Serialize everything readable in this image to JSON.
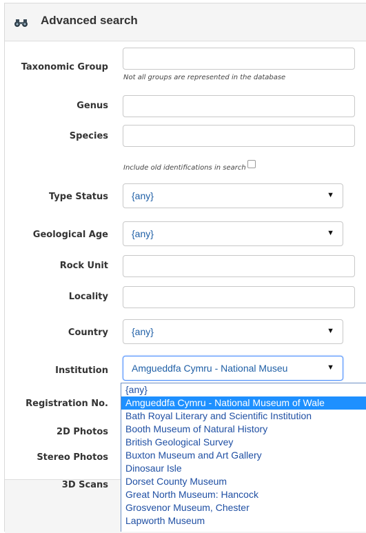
{
  "header": {
    "title": "Advanced search",
    "icon": "binoculars-icon"
  },
  "fields": {
    "taxonomic_group": {
      "label": "Taxonomic Group",
      "value": "",
      "hint": "Not all groups are represented in the database"
    },
    "genus": {
      "label": "Genus",
      "value": ""
    },
    "species": {
      "label": "Species",
      "value": ""
    },
    "old_identifications": {
      "label": "Include old identifications in search",
      "checked": false
    },
    "type_status": {
      "label": "Type Status",
      "selected": "{any}"
    },
    "geological_age": {
      "label": "Geological Age",
      "selected": "{any}"
    },
    "rock_unit": {
      "label": "Rock Unit",
      "value": ""
    },
    "locality": {
      "label": "Locality",
      "value": ""
    },
    "country": {
      "label": "Country",
      "selected": "{any}"
    },
    "institution": {
      "label": "Institution",
      "selected": "Amgueddfa Cymru - National Museu"
    },
    "registration_no": {
      "label": "Registration No."
    },
    "photos_2d": {
      "label": "2D Photos"
    },
    "stereo_photos": {
      "label": "Stereo Photos"
    },
    "scans_3d": {
      "label": "3D Scans"
    }
  },
  "institution_options": [
    "{any}",
    "Amgueddfa Cymru - National Museum of Wale",
    "Bath Royal Literary and Scientific Institution",
    "Booth Museum of Natural History",
    "British Geological Survey",
    "Buxton Museum and Art Gallery",
    "Dinosaur Isle",
    "Dorset County Museum",
    "Great North Museum: Hancock",
    "Grosvenor Museum, Chester",
    "Lapworth Museum"
  ],
  "institution_selected_index": 1,
  "colors": {
    "link_blue": "#1f4fa3",
    "highlight": "#1e90ff",
    "header_bg": "#f5f5f5"
  }
}
